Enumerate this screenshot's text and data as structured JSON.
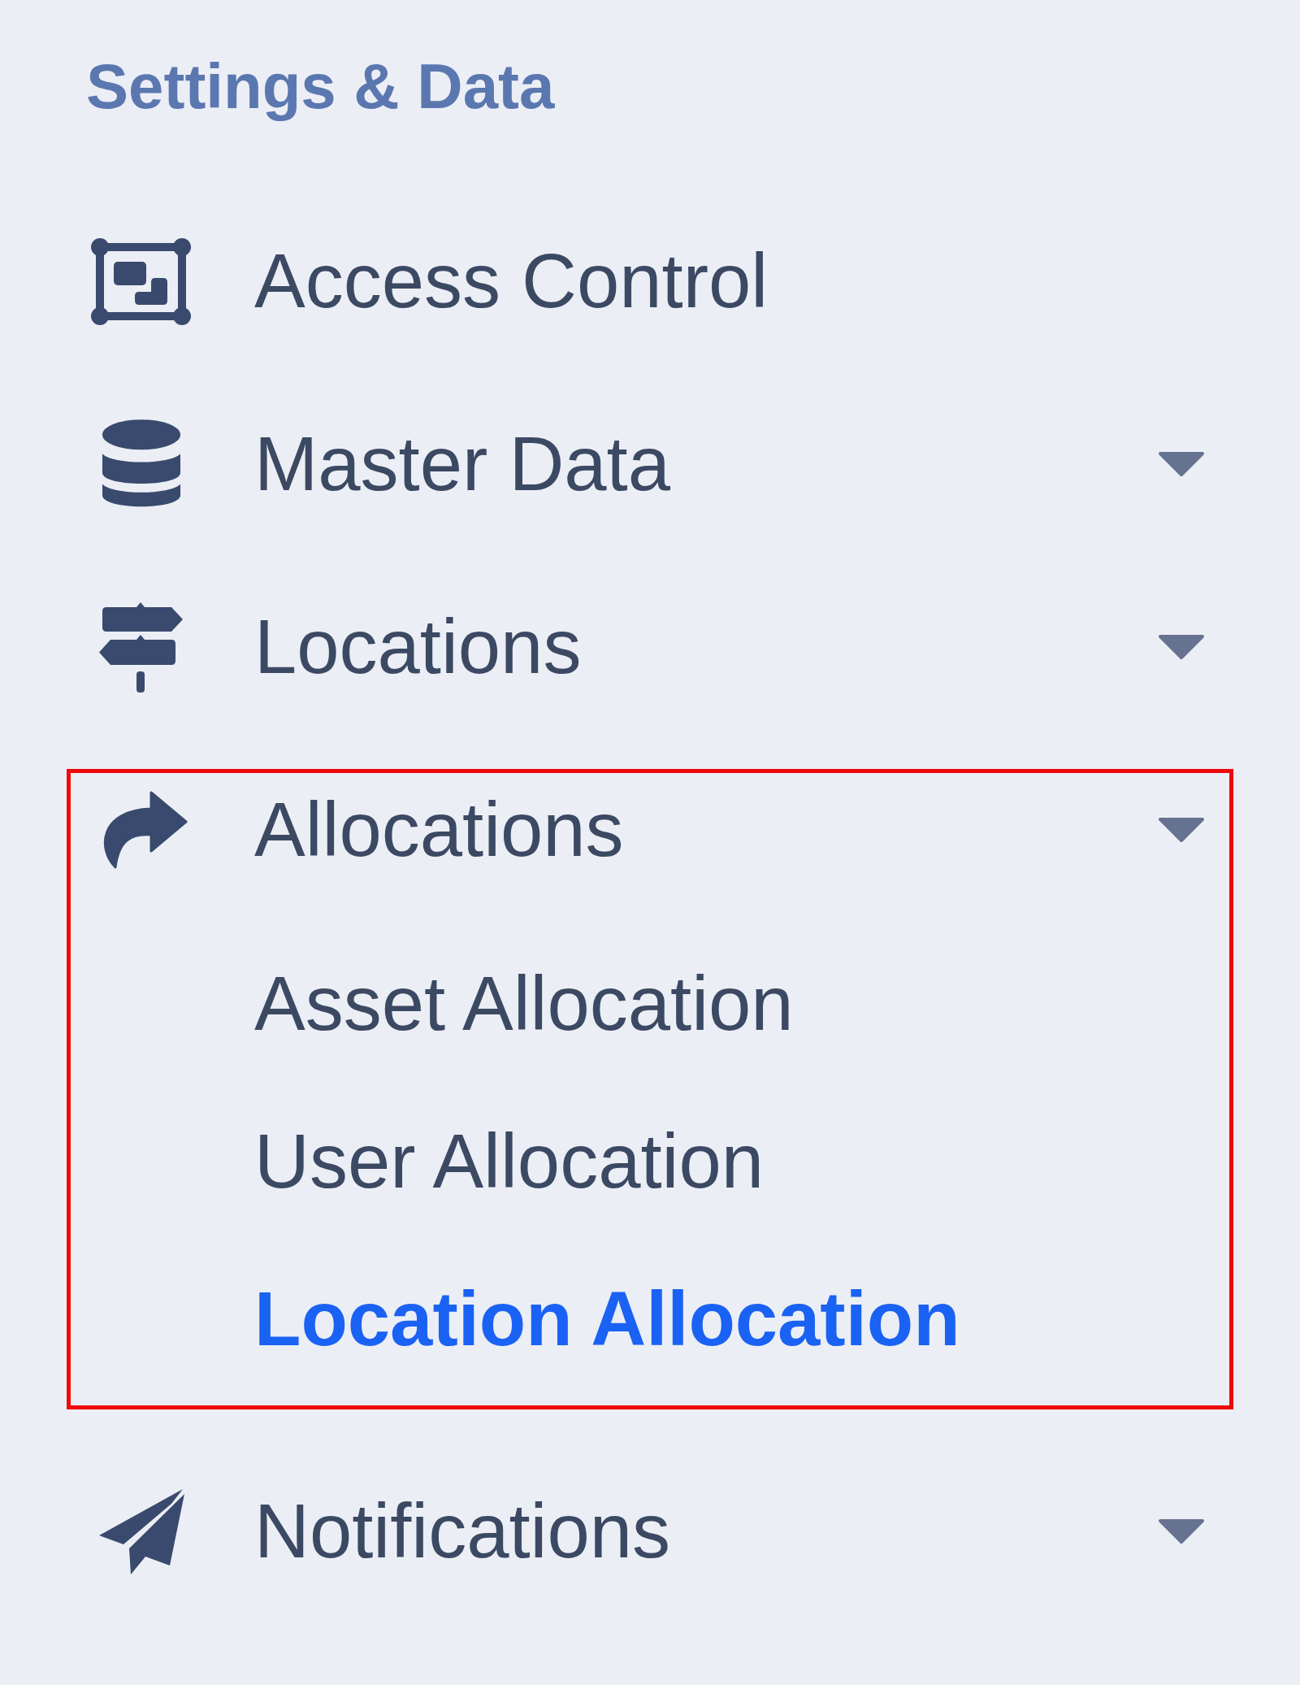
{
  "section_title": "Settings & Data",
  "menu": [
    {
      "label": "Access Control",
      "kind": "link",
      "highlighted": false
    },
    {
      "label": "Master Data",
      "kind": "dropdown",
      "highlighted": false
    },
    {
      "label": "Locations",
      "kind": "dropdown",
      "highlighted": false
    },
    {
      "label": "Allocations",
      "kind": "dropdown",
      "highlighted": true,
      "children": [
        {
          "label": "Asset Allocation",
          "selected": false
        },
        {
          "label": "User Allocation",
          "selected": false
        },
        {
          "label": "Location Allocation",
          "selected": true
        }
      ]
    },
    {
      "label": "Notifications",
      "kind": "dropdown",
      "highlighted": false
    }
  ]
}
